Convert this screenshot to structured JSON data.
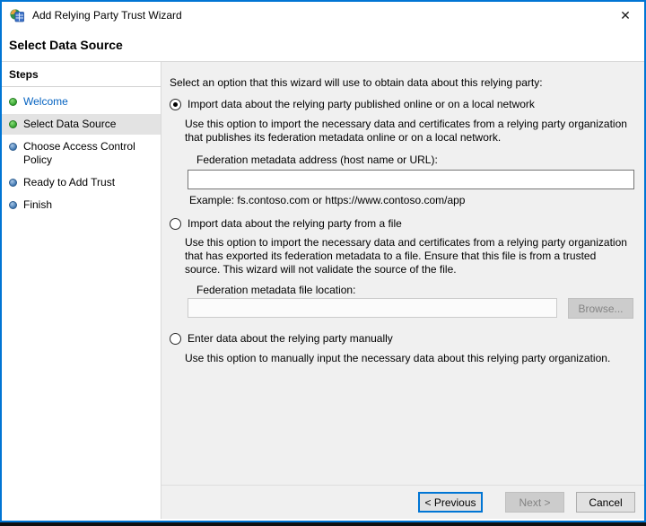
{
  "window": {
    "title": "Add Relying Party Trust Wizard",
    "close_glyph": "✕",
    "border_color": "#0075d4"
  },
  "header": {
    "title": "Select Data Source"
  },
  "sidebar": {
    "title": "Steps",
    "steps": [
      {
        "label": "Welcome",
        "state": "visited"
      },
      {
        "label": "Select Data Source",
        "state": "current"
      },
      {
        "label": "Choose Access Control Policy",
        "state": "pending"
      },
      {
        "label": "Ready to Add Trust",
        "state": "pending"
      },
      {
        "label": "Finish",
        "state": "pending"
      }
    ],
    "bullet_colors": {
      "done": "#2f9e2b",
      "pending": "#3a72ad"
    }
  },
  "main": {
    "intro": "Select an option that this wizard will use to obtain data about this relying party:",
    "options": [
      {
        "label": "Import data about the relying party published online or on a local network",
        "selected": true,
        "description": "Use this option to import the necessary data and certificates from a relying party organization that publishes its federation metadata online or on a local network.",
        "field_label": "Federation metadata address (host name or URL):",
        "field_value": "",
        "example": "Example: fs.contoso.com or https://www.contoso.com/app"
      },
      {
        "label": "Import data about the relying party from a file",
        "selected": false,
        "description": "Use this option to import the necessary data and certificates from a relying party organization that has exported its federation metadata to a file. Ensure that this file is from a trusted source.  This wizard will not validate the source of the file.",
        "field_label": "Federation metadata file location:",
        "field_value": "",
        "browse_label": "Browse..."
      },
      {
        "label": "Enter data about the relying party manually",
        "selected": false,
        "description": "Use this option to manually input the necessary data about this relying party organization."
      }
    ]
  },
  "footer": {
    "previous_label": "< Previous",
    "next_label": "Next >",
    "cancel_label": "Cancel"
  }
}
